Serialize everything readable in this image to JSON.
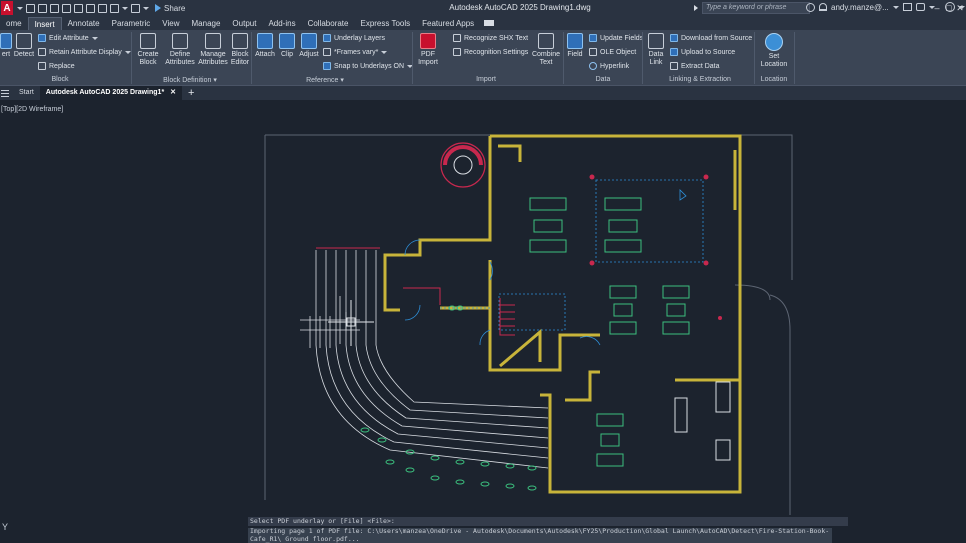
{
  "titlebar": {
    "app_logo": "A",
    "share_label": "Share",
    "document_title": "Autodesk AutoCAD 2025  Drawing1.dwg",
    "search_placeholder": "Type a keyword or phrase",
    "user_name": "andy.manze@..."
  },
  "ribbon_tabs": [
    "ome",
    "Insert",
    "Annotate",
    "Parametric",
    "View",
    "Manage",
    "Output",
    "Add-ins",
    "Collaborate",
    "Express Tools",
    "Featured Apps"
  ],
  "active_ribbon_tab": "Insert",
  "ribbon": {
    "block": {
      "label": "Block",
      "insert": "ert",
      "detect": "Detect",
      "edit_attribute": "Edit Attribute",
      "retain_attribute_display": "Retain Attribute Display",
      "replace": "Replace"
    },
    "block_definition": {
      "label": "Block Definition",
      "create_block": [
        "Create",
        "Block"
      ],
      "define_attributes": [
        "Define",
        "Attributes"
      ],
      "manage_attributes": [
        "Manage",
        "Attributes"
      ],
      "block_editor": [
        "Block",
        "Editor"
      ]
    },
    "reference": {
      "label": "Reference",
      "attach": "Attach",
      "clip": "Clip",
      "adjust": "Adjust",
      "underlay_layers": "Underlay Layers",
      "frames_vary": "*Frames vary*",
      "snap_to_underlays": "Snap to Underlays ON"
    },
    "import": {
      "label": "Import",
      "pdf_import": [
        "PDF",
        "Import"
      ],
      "recognize_shx": "Recognize SHX Text",
      "recognition_settings": "Recognition Settings",
      "combine_text": [
        "Combine",
        "Text"
      ]
    },
    "data": {
      "label": "Data",
      "field": "Field",
      "update_fields": "Update Fields",
      "ole_object": "OLE Object",
      "hyperlink": "Hyperlink"
    },
    "linking": {
      "label": "Linking & Extraction",
      "data_link": [
        "Data",
        "Link"
      ],
      "download_from_source": "Download from Source",
      "upload_to_source": "Upload to Source",
      "extract_data": "Extract  Data"
    },
    "location": {
      "label": "Location",
      "set_location": [
        "Set",
        "Location"
      ]
    }
  },
  "doc_tabs": {
    "start": "Start",
    "active": "Autodesk AutoCAD 2025 Drawing1*"
  },
  "viewport_label": "[Top][2D Wireframe]",
  "ucs_label": "Y",
  "command": {
    "history": "Select PDF underlay or [File] <File>:",
    "line1": "Importing page 1 of PDF file: C:\\Users\\manzea\\OneDrive - Autodesk\\Documents\\Autodesk\\FY25\\Production\\Global Launch\\AutoCAD\\Detect\\Fire-Station-Book-",
    "line2": "Cafe_R1\\ Ground floor.pdf..."
  },
  "colors": {
    "wall": "#c8b43a",
    "furniture": "#3bbf7e",
    "site": "#d9dde3",
    "red": "#c8284e",
    "blue_dash": "#2e8fd8",
    "accent_red": "#c8102e"
  }
}
